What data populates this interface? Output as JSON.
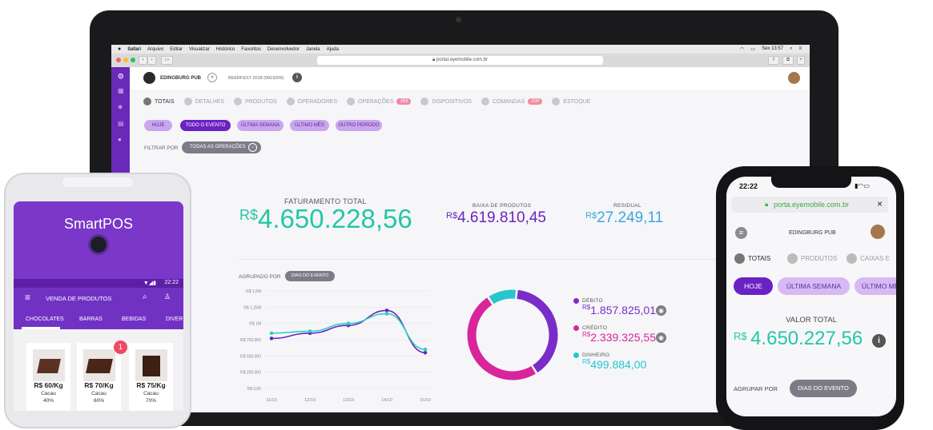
{
  "browser": {
    "menu": [
      "Safari",
      "Arquivo",
      "Editar",
      "Visualizar",
      "Histórico",
      "Favoritos",
      "Desenvolvedor",
      "Janela",
      "Ajuda"
    ],
    "clock": "Sex 13:57",
    "url": "portal.eyemobile.com.br"
  },
  "app": {
    "venue": "EDINGBURG PUB",
    "event": "BEERFEST 2018 (0819209)",
    "tabs": [
      {
        "label": "TOTAIS",
        "badge": ""
      },
      {
        "label": "DETALHES",
        "badge": ""
      },
      {
        "label": "PRODUTOS",
        "badge": ""
      },
      {
        "label": "OPERADORES",
        "badge": ""
      },
      {
        "label": "OPERAÇÕES",
        "badge": "163"
      },
      {
        "label": "DISPOSITIVOS",
        "badge": ""
      },
      {
        "label": "COMANDAS",
        "badge": "200"
      },
      {
        "label": "ESTOQUE",
        "badge": ""
      }
    ],
    "periods": [
      "HOJE",
      "TODO O EVENTO",
      "ÚLTIMA SEMANA",
      "ÚLTIMO MÊS",
      "OUTRO PERÍODO"
    ],
    "filter_label": "FILTRAR POR",
    "filter_value": "TODAS AS OPERAÇÕES",
    "kpi": {
      "total_label": "FATURAMENTO TOTAL",
      "currency": "R$",
      "total_value": "4.650.228,56",
      "baixa_label": "BAIXA DE PRODUTOS",
      "baixa_value": "4.619.810,45",
      "residual_label": "RESIDUAL",
      "residual_value": "27.249,11"
    },
    "group_label": "AGRUPADO POR",
    "group_value": "DIAS DO EVENTO",
    "legend": [
      {
        "label": "DÉBITO",
        "value": "1.857.825,01",
        "color": "#7a2cc9"
      },
      {
        "label": "CRÉDITO",
        "value": "2.339.325,55",
        "color": "#d8259b"
      },
      {
        "label": "DINHEIRO",
        "value": "499.884,00",
        "color": "#26c6cf"
      }
    ],
    "donut": [
      {
        "name": "DÉBITO",
        "value": 1857825.01,
        "color": "#7a2cc9"
      },
      {
        "name": "CRÉDITO",
        "value": 2339325.55,
        "color": "#d8259b"
      },
      {
        "name": "DINHEIRO",
        "value": 499884.0,
        "color": "#26c6cf"
      }
    ]
  },
  "chart_data": {
    "type": "line",
    "x": [
      "11/10",
      "12/10",
      "13/10",
      "14/10",
      "15/10"
    ],
    "y_ticks": [
      "R$ 0,00",
      "R$ 250.000",
      "R$ 500.000",
      "R$ 750.000",
      "R$ 1M",
      "R$ 1,25M",
      "R$ 1,5M"
    ],
    "ylim": [
      0,
      1500000
    ],
    "series": [
      {
        "color": "#6a24c0",
        "values": [
          770000,
          850000,
          970000,
          1200000,
          550000
        ]
      },
      {
        "color": "#2fd0bf",
        "values": [
          850000,
          880000,
          1000000,
          1150000,
          600000
        ]
      }
    ]
  },
  "smartpos": {
    "brand": "SmartPOS",
    "time": "22:22",
    "title": "VENDA DE PRODUTOS",
    "categories": [
      "CHOCOLATES",
      "BARRAS",
      "BEBIDAS",
      "DIVER"
    ],
    "products": [
      {
        "price": "R$ 60/Kg",
        "name": "Cacau",
        "pct": "40%",
        "badge": ""
      },
      {
        "price": "R$ 70/Kg",
        "name": "Cacau",
        "pct": "60%",
        "badge": "1"
      },
      {
        "price": "R$ 75/Kg",
        "name": "Cacau",
        "pct": "70%",
        "badge": ""
      }
    ]
  },
  "iphone": {
    "time": "22:22",
    "url": "porta.eyemobile.com.br",
    "venue": "EDINGBURG PUB",
    "tabs": [
      "TOTAIS",
      "PRODUTOS",
      "CAIXAS E"
    ],
    "periods": [
      "HOJE",
      "ÚLTIMA SEMANA",
      "ÚLTIMO MÊS"
    ],
    "total_label": "VALOR TOTAL",
    "currency": "R$",
    "total_value": "4.650.227,56",
    "group_label": "AGRUPAR POR",
    "group_value": "DIAS DO EVENTO"
  }
}
